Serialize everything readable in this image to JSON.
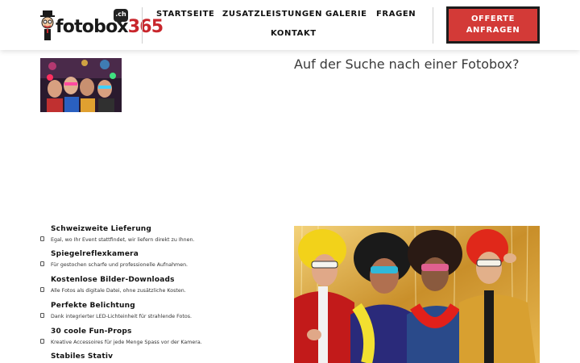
{
  "header": {
    "logo": {
      "text_main": "fotobox",
      "text_accent": "365",
      "badge": ".ch"
    },
    "nav": [
      {
        "label": "STARTSEITE"
      },
      {
        "label": "ZUSATZLEISTUNGEN"
      },
      {
        "label": "GALERIE"
      },
      {
        "label": "FRAGEN"
      },
      {
        "label": "KONTAKT"
      }
    ],
    "cta_label": "OFFERTE ANFRAGEN"
  },
  "hero": {
    "title": "Auf der Suche nach einer Fotobox?"
  },
  "features": [
    {
      "title": "Schweizweite Lieferung",
      "desc": "Egal, wo Ihr Event stattfindet, wir liefern direkt zu Ihnen.",
      "icon": "check-icon"
    },
    {
      "title": "Spiegelreflexkamera",
      "desc": "Für gestochen scharfe und professionelle Aufnahmen.",
      "icon": "check-icon"
    },
    {
      "title": "Kostenlose Bilder-Downloads",
      "desc": "Alle Fotos als digitale Datei, ohne zusätzliche Kosten.",
      "icon": "check-icon"
    },
    {
      "title": "Perfekte Belichtung",
      "desc": "Dank integrierter LED-Lichteinheit für strahlende Fotos.",
      "icon": "check-icon"
    },
    {
      "title": "30 coole Fun-Props",
      "desc": "Kreative Accessoires für jede Menge Spass vor der Kamera.",
      "icon": "check-icon"
    },
    {
      "title": "Stabiles Stativ",
      "desc": "",
      "icon": "check-icon"
    }
  ],
  "colors": {
    "accent": "#d33a37",
    "text": "#222222",
    "gold": "#d9a23a"
  }
}
